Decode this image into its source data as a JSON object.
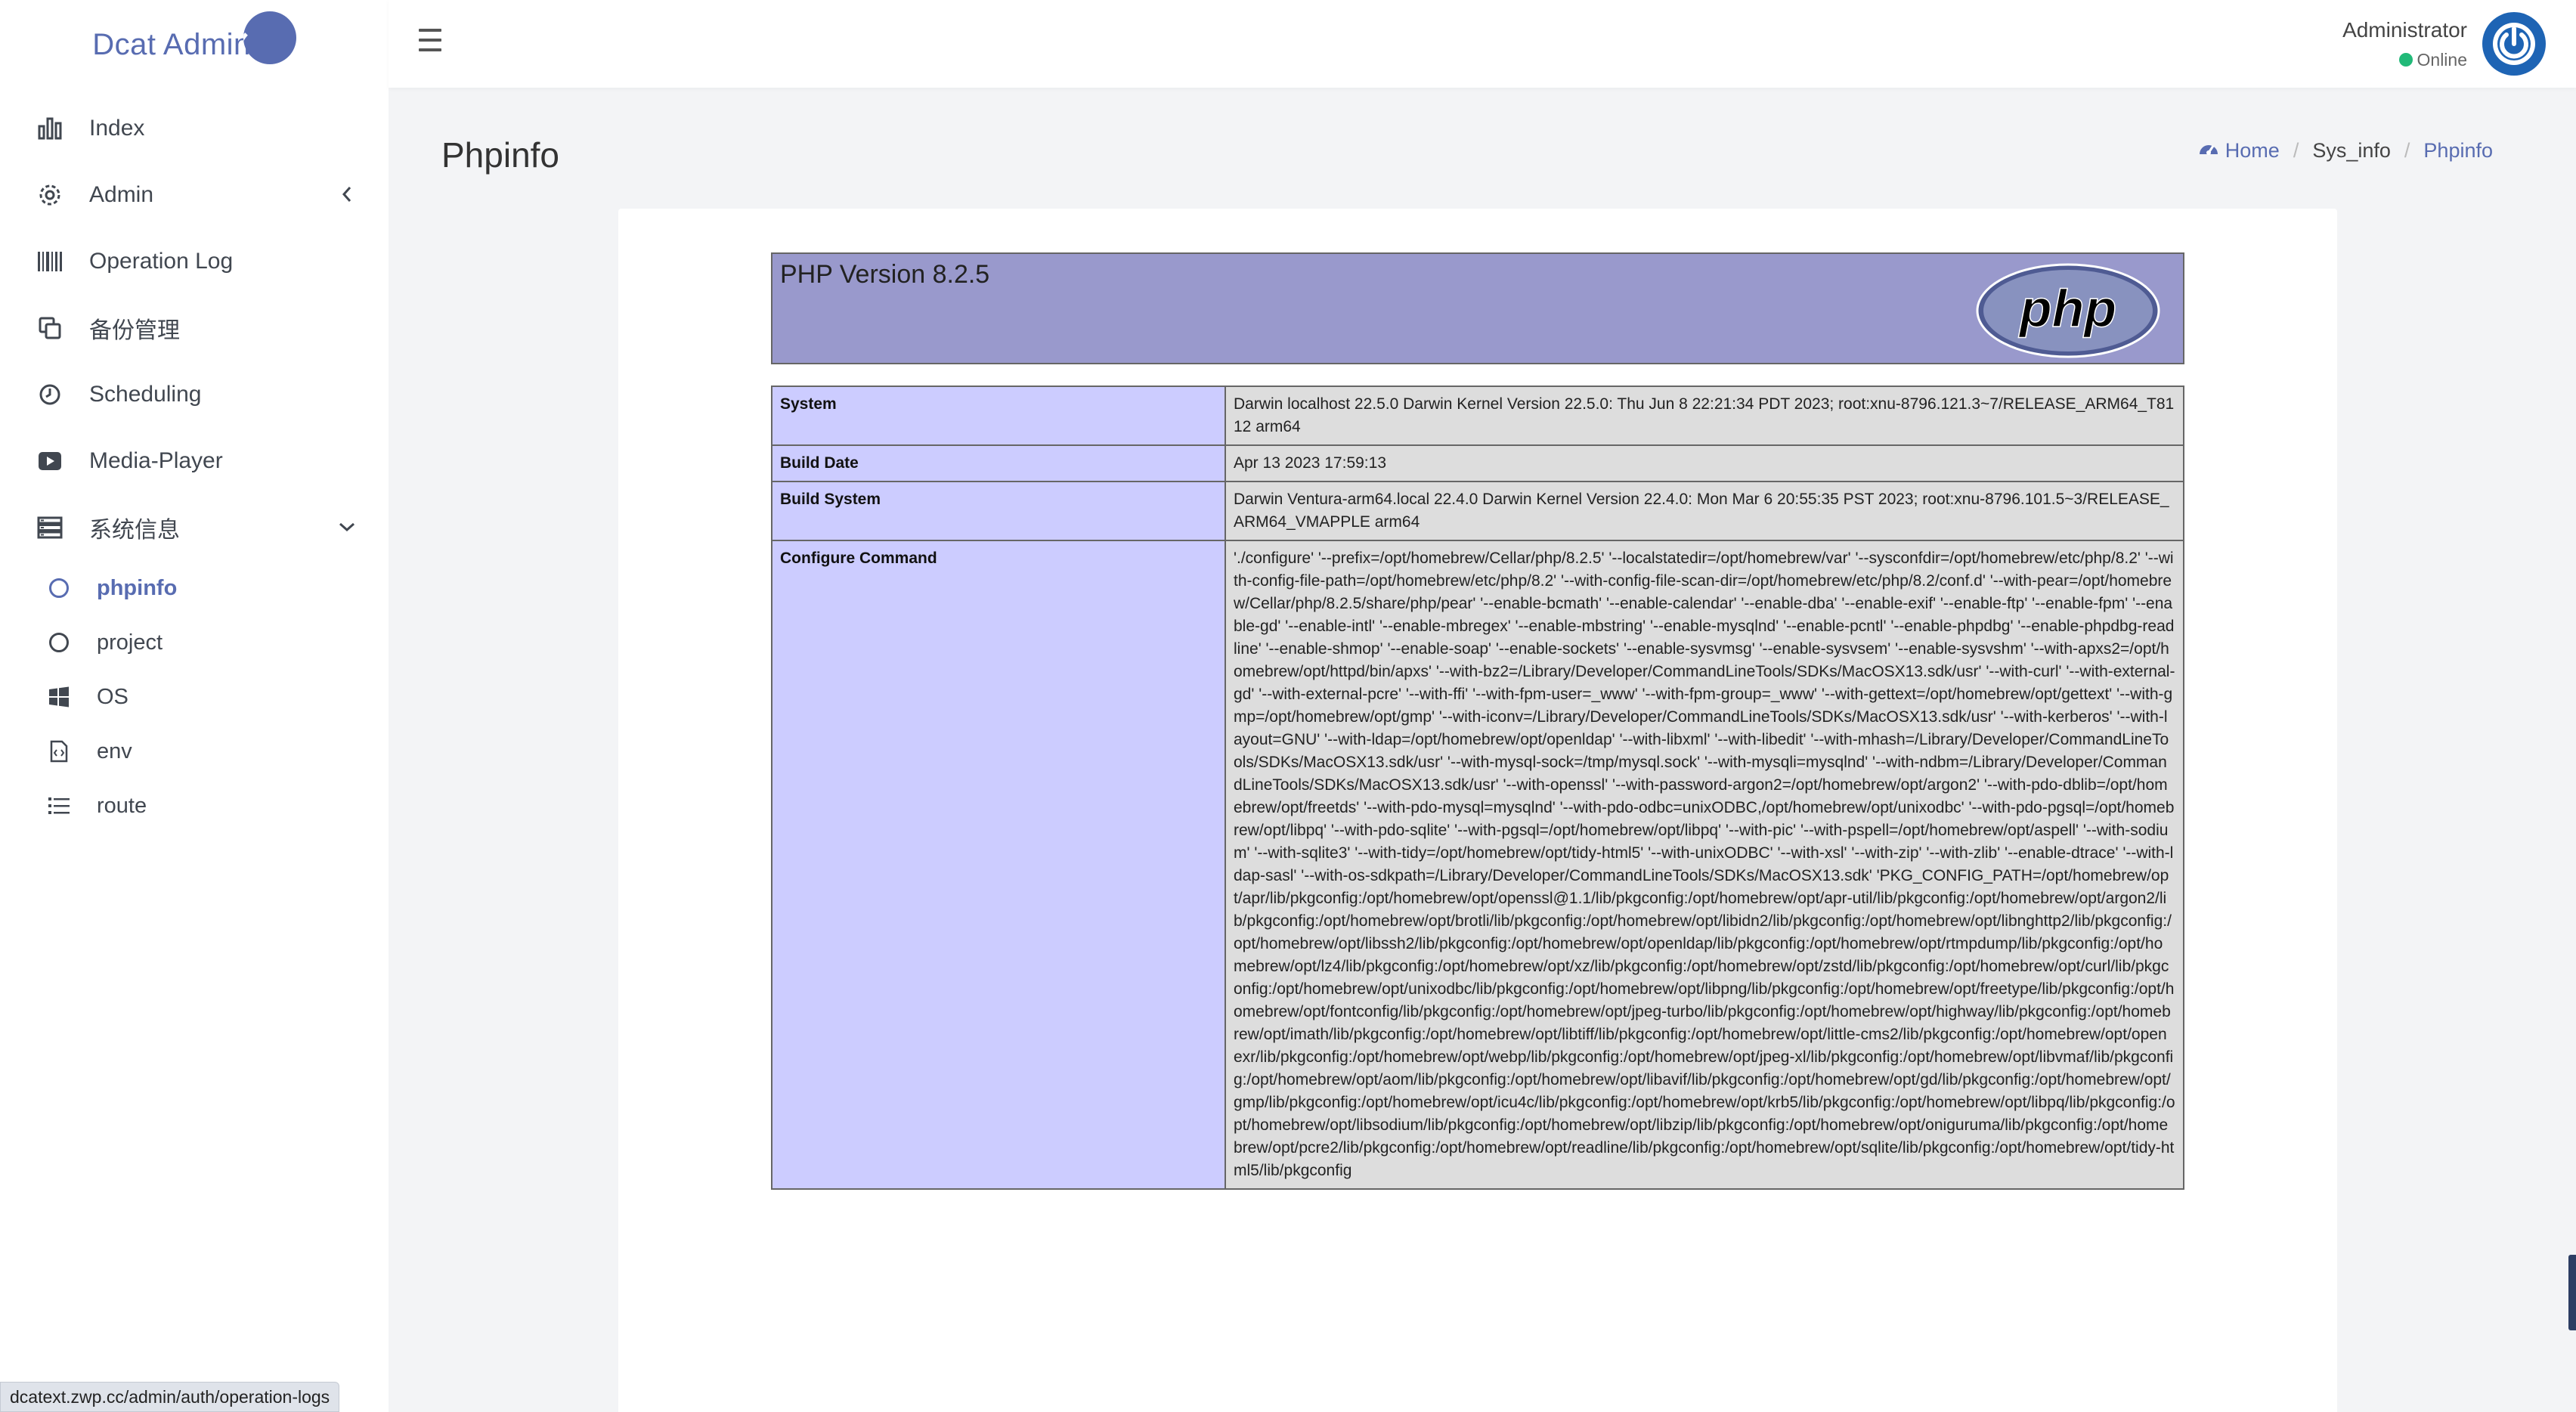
{
  "brand": {
    "name": "Dcat Admin"
  },
  "sidebar": {
    "items": [
      {
        "label": "Index",
        "icon": "bar-chart-icon"
      },
      {
        "label": "Admin",
        "icon": "gear-icon"
      },
      {
        "label": "Operation Log",
        "icon": "barcode-icon"
      },
      {
        "label": "备份管理",
        "icon": "copy-icon"
      },
      {
        "label": "Scheduling",
        "icon": "clock-icon"
      },
      {
        "label": "Media-Player",
        "icon": "video-icon"
      },
      {
        "label": "系统信息",
        "icon": "server-icon"
      }
    ],
    "sub_items": [
      {
        "label": "phpinfo",
        "icon": "circle-icon"
      },
      {
        "label": "project",
        "icon": "circle-icon"
      },
      {
        "label": "OS",
        "icon": "windows-icon"
      },
      {
        "label": "env",
        "icon": "code-file-icon"
      },
      {
        "label": "route",
        "icon": "list-icon"
      }
    ]
  },
  "header": {
    "user_name": "Administrator",
    "user_status": "Online"
  },
  "page": {
    "title": "Phpinfo",
    "breadcrumb": [
      "Home",
      "Sys_info",
      "Phpinfo"
    ]
  },
  "phpinfo": {
    "version": "PHP Version 8.2.5",
    "logo_text": "php",
    "rows": [
      {
        "key": "System",
        "value": "Darwin localhost 22.5.0 Darwin Kernel Version 22.5.0: Thu Jun 8 22:21:34 PDT 2023; root:xnu-8796.121.3~7/RELEASE_ARM64_T8112 arm64"
      },
      {
        "key": "Build Date",
        "value": "Apr 13 2023 17:59:13"
      },
      {
        "key": "Build System",
        "value": "Darwin Ventura-arm64.local 22.4.0 Darwin Kernel Version 22.4.0: Mon Mar 6 20:55:35 PST 2023; root:xnu-8796.101.5~3/RELEASE_ARM64_VMAPPLE arm64"
      },
      {
        "key": "Configure Command",
        "value": "'./configure' '--prefix=/opt/homebrew/Cellar/php/8.2.5' '--localstatedir=/opt/homebrew/var' '--sysconfdir=/opt/homebrew/etc/php/8.2' '--with-config-file-path=/opt/homebrew/etc/php/8.2' '--with-config-file-scan-dir=/opt/homebrew/etc/php/8.2/conf.d' '--with-pear=/opt/homebrew/Cellar/php/8.2.5/share/php/pear' '--enable-bcmath' '--enable-calendar' '--enable-dba' '--enable-exif' '--enable-ftp' '--enable-fpm' '--enable-gd' '--enable-intl' '--enable-mbregex' '--enable-mbstring' '--enable-mysqlnd' '--enable-pcntl' '--enable-phpdbg' '--enable-phpdbg-readline' '--enable-shmop' '--enable-soap' '--enable-sockets' '--enable-sysvmsg' '--enable-sysvsem' '--enable-sysvshm' '--with-apxs2=/opt/homebrew/opt/httpd/bin/apxs' '--with-bz2=/Library/Developer/CommandLineTools/SDKs/MacOSX13.sdk/usr' '--with-curl' '--with-external-gd' '--with-external-pcre' '--with-ffi' '--with-fpm-user=_www' '--with-fpm-group=_www' '--with-gettext=/opt/homebrew/opt/gettext' '--with-gmp=/opt/homebrew/opt/gmp' '--with-iconv=/Library/Developer/CommandLineTools/SDKs/MacOSX13.sdk/usr' '--with-kerberos' '--with-layout=GNU' '--with-ldap=/opt/homebrew/opt/openldap' '--with-libxml' '--with-libedit' '--with-mhash=/Library/Developer/CommandLineTools/SDKs/MacOSX13.sdk/usr' '--with-mysql-sock=/tmp/mysql.sock' '--with-mysqli=mysqlnd' '--with-ndbm=/Library/Developer/CommandLineTools/SDKs/MacOSX13.sdk/usr' '--with-openssl' '--with-password-argon2=/opt/homebrew/opt/argon2' '--with-pdo-dblib=/opt/homebrew/opt/freetds' '--with-pdo-mysql=mysqlnd' '--with-pdo-odbc=unixODBC,/opt/homebrew/opt/unixodbc' '--with-pdo-pgsql=/opt/homebrew/opt/libpq' '--with-pdo-sqlite' '--with-pgsql=/opt/homebrew/opt/libpq' '--with-pic' '--with-pspell=/opt/homebrew/opt/aspell' '--with-sodium' '--with-sqlite3' '--with-tidy=/opt/homebrew/opt/tidy-html5' '--with-unixODBC' '--with-xsl' '--with-zip' '--with-zlib' '--enable-dtrace' '--with-ldap-sasl' '--with-os-sdkpath=/Library/Developer/CommandLineTools/SDKs/MacOSX13.sdk' 'PKG_CONFIG_PATH=/opt/homebrew/opt/apr/lib/pkgconfig:/opt/homebrew/opt/openssl@1.1/lib/pkgconfig:/opt/homebrew/opt/apr-util/lib/pkgconfig:/opt/homebrew/opt/argon2/lib/pkgconfig:/opt/homebrew/opt/brotli/lib/pkgconfig:/opt/homebrew/opt/libidn2/lib/pkgconfig:/opt/homebrew/opt/libnghttp2/lib/pkgconfig:/opt/homebrew/opt/libssh2/lib/pkgconfig:/opt/homebrew/opt/openldap/lib/pkgconfig:/opt/homebrew/opt/rtmpdump/lib/pkgconfig:/opt/homebrew/opt/lz4/lib/pkgconfig:/opt/homebrew/opt/xz/lib/pkgconfig:/opt/homebrew/opt/zstd/lib/pkgconfig:/opt/homebrew/opt/curl/lib/pkgconfig:/opt/homebrew/opt/unixodbc/lib/pkgconfig:/opt/homebrew/opt/libpng/lib/pkgconfig:/opt/homebrew/opt/freetype/lib/pkgconfig:/opt/homebrew/opt/fontconfig/lib/pkgconfig:/opt/homebrew/opt/jpeg-turbo/lib/pkgconfig:/opt/homebrew/opt/highway/lib/pkgconfig:/opt/homebrew/opt/imath/lib/pkgconfig:/opt/homebrew/opt/libtiff/lib/pkgconfig:/opt/homebrew/opt/little-cms2/lib/pkgconfig:/opt/homebrew/opt/openexr/lib/pkgconfig:/opt/homebrew/opt/webp/lib/pkgconfig:/opt/homebrew/opt/jpeg-xl/lib/pkgconfig:/opt/homebrew/opt/libvmaf/lib/pkgconfig:/opt/homebrew/opt/aom/lib/pkgconfig:/opt/homebrew/opt/libavif/lib/pkgconfig:/opt/homebrew/opt/gd/lib/pkgconfig:/opt/homebrew/opt/gmp/lib/pkgconfig:/opt/homebrew/opt/icu4c/lib/pkgconfig:/opt/homebrew/opt/krb5/lib/pkgconfig:/opt/homebrew/opt/libpq/lib/pkgconfig:/opt/homebrew/opt/libsodium/lib/pkgconfig:/opt/homebrew/opt/libzip/lib/pkgconfig:/opt/homebrew/opt/oniguruma/lib/pkgconfig:/opt/homebrew/opt/pcre2/lib/pkgconfig:/opt/homebrew/opt/readline/lib/pkgconfig:/opt/homebrew/opt/sqlite/lib/pkgconfig:/opt/homebrew/opt/tidy-html5/lib/pkgconfig"
      }
    ]
  },
  "status_bar": {
    "url": "dcatext.zwp.cc/admin/auth/operation-logs"
  },
  "colors": {
    "accent": "#586cb1",
    "php_header": "#9999cc",
    "php_key": "#ccccff",
    "php_value": "#dddddd",
    "online": "#21b978",
    "avatar": "#1e64b4"
  }
}
